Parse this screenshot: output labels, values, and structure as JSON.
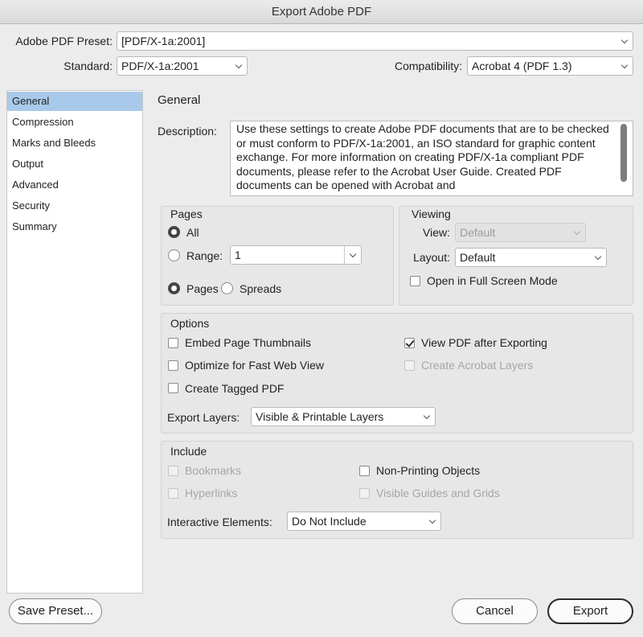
{
  "window": {
    "title": "Export Adobe PDF"
  },
  "preset": {
    "label": "Adobe PDF Preset:",
    "value": "[PDF/X-1a:2001]"
  },
  "standard": {
    "label": "Standard:",
    "value": "PDF/X-1a:2001"
  },
  "compatibility": {
    "label": "Compatibility:",
    "value": "Acrobat 4 (PDF 1.3)"
  },
  "sidebar": {
    "items": [
      {
        "label": "General",
        "selected": true
      },
      {
        "label": "Compression"
      },
      {
        "label": "Marks and Bleeds"
      },
      {
        "label": "Output"
      },
      {
        "label": "Advanced"
      },
      {
        "label": "Security"
      },
      {
        "label": "Summary"
      }
    ]
  },
  "section_title": "General",
  "description": {
    "label": "Description:",
    "text": "Use these settings to create Adobe PDF documents that are to be checked or must conform to PDF/X-1a:2001, an ISO standard for graphic content exchange.  For more information on creating PDF/X-1a compliant PDF documents, please refer to the Acrobat User Guide.  Created PDF documents can be opened with Acrobat and"
  },
  "pages": {
    "title": "Pages",
    "all_label": "All",
    "range_label": "Range:",
    "range_value": "1",
    "pages_label": "Pages",
    "spreads_label": "Spreads"
  },
  "viewing": {
    "title": "Viewing",
    "view_label": "View:",
    "view_value": "Default",
    "layout_label": "Layout:",
    "layout_value": "Default",
    "fullscreen_label": "Open in Full Screen Mode"
  },
  "options": {
    "title": "Options",
    "embed_thumbnails": "Embed Page Thumbnails",
    "optimize_web": "Optimize for Fast Web View",
    "tagged_pdf": "Create Tagged PDF",
    "view_after": "View PDF after Exporting",
    "acrobat_layers": "Create Acrobat Layers",
    "export_layers_label": "Export Layers:",
    "export_layers_value": "Visible & Printable Layers"
  },
  "include": {
    "title": "Include",
    "bookmarks": "Bookmarks",
    "hyperlinks": "Hyperlinks",
    "non_printing": "Non-Printing Objects",
    "guides_grids": "Visible Guides and Grids",
    "interactive_label": "Interactive Elements:",
    "interactive_value": "Do Not Include"
  },
  "buttons": {
    "save_preset": "Save Preset...",
    "cancel": "Cancel",
    "export": "Export"
  }
}
